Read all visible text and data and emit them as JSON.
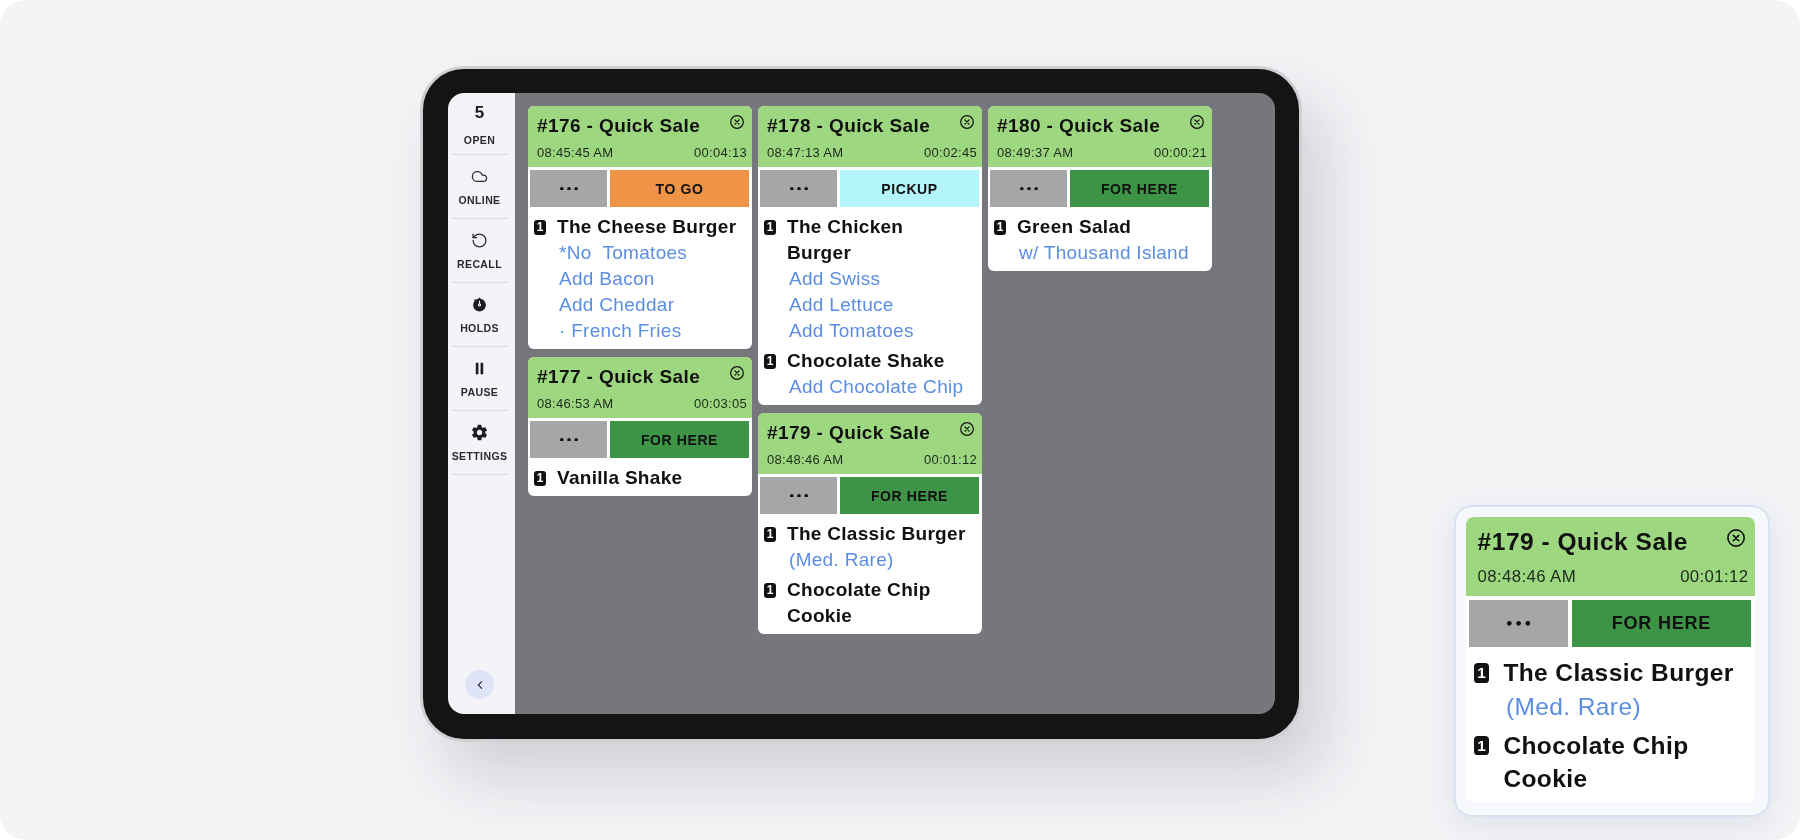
{
  "sidebar": {
    "items": [
      {
        "kind": "count",
        "count": "5",
        "label": "OPEN"
      },
      {
        "kind": "button",
        "label": "ONLINE"
      },
      {
        "kind": "button",
        "label": "RECALL"
      },
      {
        "kind": "button",
        "label": "HOLDS"
      },
      {
        "kind": "button",
        "label": "PAUSE"
      },
      {
        "kind": "button",
        "label": "SETTINGS"
      }
    ]
  },
  "board": {
    "columns": [
      {
        "orders": [
          {
            "title": "#176 - Quick Sale",
            "placed_at": "08:45:45 AM",
            "elapsed": "00:04:13",
            "order_type": {
              "label": "TO GO",
              "color": "#ef9447"
            },
            "items": [
              {
                "quantity": "1",
                "name": "The Cheese Burger",
                "modifiers": [
                  "*No  Tomatoes",
                  "Add Bacon",
                  "Add Cheddar",
                  "· French Fries"
                ]
              }
            ]
          },
          {
            "title": "#177 - Quick Sale",
            "placed_at": "08:46:53 AM",
            "elapsed": "00:03:05",
            "order_type": {
              "label": "FOR HERE",
              "color": "#3e9446"
            },
            "items": [
              {
                "quantity": "1",
                "name": "Vanilla Shake"
              }
            ]
          }
        ]
      },
      {
        "orders": [
          {
            "title": "#178 - Quick Sale",
            "placed_at": "08:47:13 AM",
            "elapsed": "00:02:45",
            "order_type": {
              "label": "PICKUP",
              "color": "#b4f4fb"
            },
            "items": [
              {
                "quantity": "1",
                "name": "The Chicken Burger",
                "modifiers": [
                  "Add Swiss",
                  "Add Lettuce",
                  "Add Tomatoes"
                ]
              },
              {
                "quantity": "1",
                "name": "Chocolate Shake",
                "modifiers": [
                  "Add Chocolate Chip"
                ]
              }
            ]
          },
          {
            "title": "#179 - Quick Sale",
            "placed_at": "08:48:46 AM",
            "elapsed": "00:01:12",
            "order_type": {
              "label": "FOR HERE",
              "color": "#3e9446"
            },
            "items": [
              {
                "quantity": "1",
                "name": "The Classic Burger",
                "modifiers": [
                  "(Med. Rare)"
                ]
              },
              {
                "quantity": "1",
                "name": "Chocolate Chip Cookie"
              }
            ]
          }
        ]
      },
      {
        "orders": [
          {
            "title": "#180 - Quick Sale",
            "placed_at": "08:49:37 AM",
            "elapsed": "00:00:21",
            "order_type": {
              "label": "FOR HERE",
              "color": "#3e9446"
            },
            "items": [
              {
                "quantity": "1",
                "name": "Green Salad",
                "modifiers": [
                  "w/ Thousand Island"
                ]
              }
            ]
          }
        ]
      }
    ]
  },
  "callout": {
    "order": {
      "title": "#179 - Quick Sale",
      "placed_at": "08:48:46 AM",
      "elapsed": "00:01:12",
      "order_type": {
        "label": "FOR HERE",
        "color": "#3e9446"
      },
      "items": [
        {
          "quantity": "1",
          "name": "The Classic Burger",
          "modifiers": [
            "(Med. Rare)"
          ]
        },
        {
          "quantity": "1",
          "name": "Chocolate Chip Cookie"
        }
      ]
    }
  }
}
